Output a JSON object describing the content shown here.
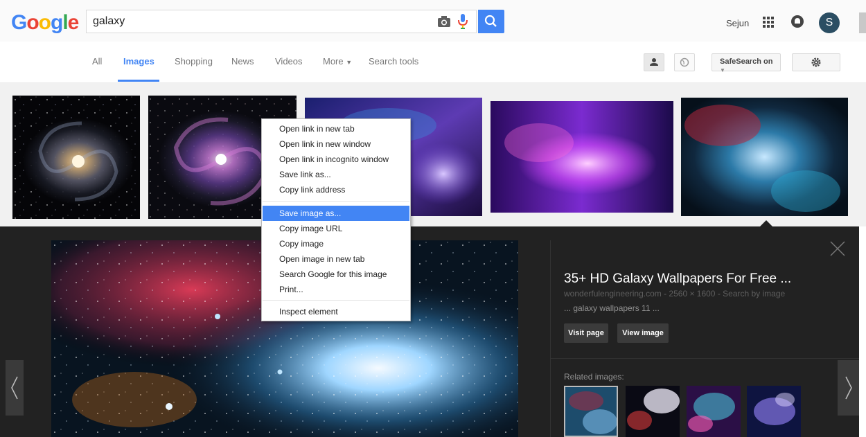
{
  "header": {
    "logo": [
      "G",
      "o",
      "o",
      "g",
      "l",
      "e"
    ],
    "logo_colors": [
      "#4285f4",
      "#ea4335",
      "#fbbc05",
      "#4285f4",
      "#34a853",
      "#ea4335"
    ],
    "search_value": "galaxy",
    "user_name": "Sejun",
    "avatar_initial": "S"
  },
  "tabs": {
    "all": "All",
    "images": "Images",
    "shopping": "Shopping",
    "news": "News",
    "videos": "Videos",
    "more": "More",
    "search_tools": "Search tools",
    "safesearch": "SafeSearch on"
  },
  "context_menu": {
    "items": [
      "Open link in new tab",
      "Open link in new window",
      "Open link in incognito window",
      "Save link as...",
      "Copy link address",
      "Save image as...",
      "Copy image URL",
      "Copy image",
      "Open image in new tab",
      "Search Google for this image",
      "Print...",
      "Inspect element"
    ],
    "highlighted_index": 5
  },
  "preview": {
    "title": "35+ HD Galaxy Wallpapers For Free ...",
    "meta": "wonderfulengineering.com - 2560 × 1600 - Search by image",
    "snippet": "... galaxy wallpapers 11 ...",
    "visit_page": "Visit page",
    "view_image": "View image",
    "related_label": "Related images:"
  },
  "colors": {
    "accent": "#4285f4",
    "panel_bg": "#222222"
  }
}
